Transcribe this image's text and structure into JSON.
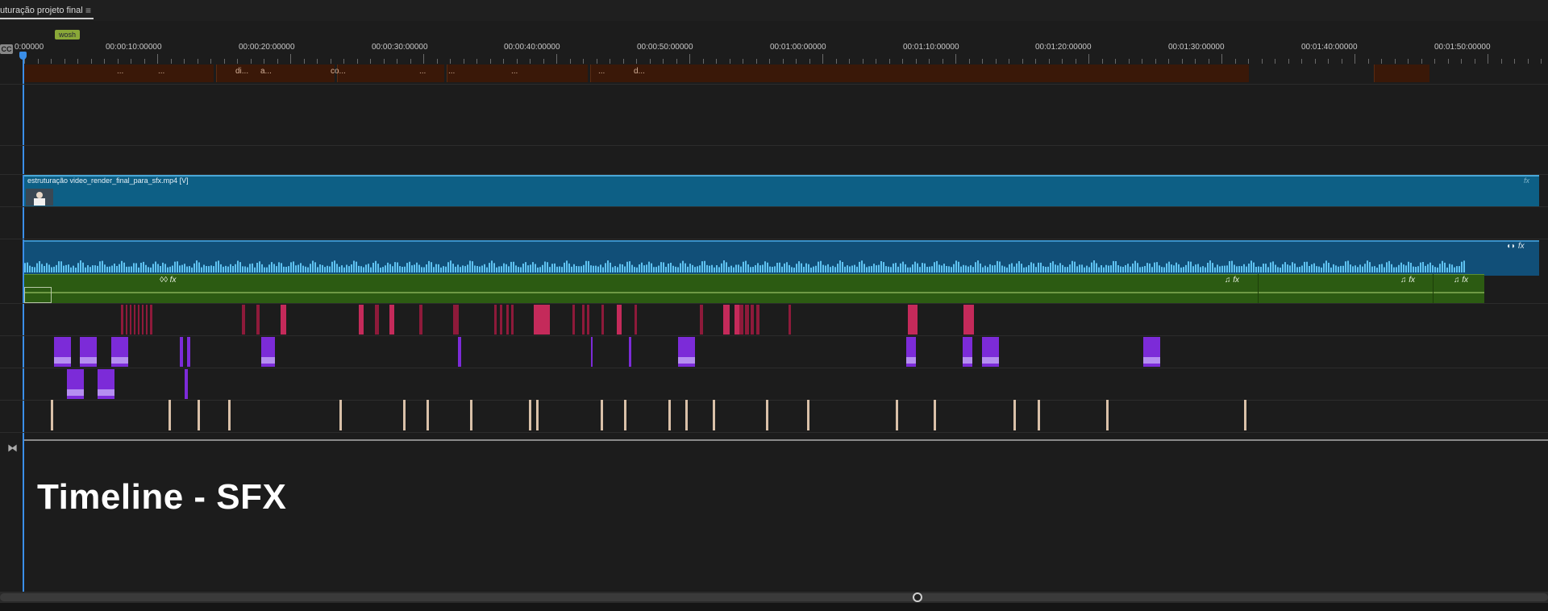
{
  "sequence": {
    "tab_title": "uturação projeto final",
    "menu_icon": "≡",
    "marker_label": "wosh",
    "cc_label": "CC"
  },
  "ruler": {
    "timecodes": [
      "0:00000",
      "00:00:10:00000",
      "00:00:20:00000",
      "00:00:30:00000",
      "00:00:40:00000",
      "00:00:50:00000",
      "00:01:00:00000",
      "00:01:10:00000",
      "00:01:20:00000",
      "00:01:30:00000",
      "00:01:40:00000",
      "00:01:50:00000"
    ]
  },
  "caption_track": {
    "labels": [
      "...",
      "...",
      "di...",
      "a...",
      "co...",
      "...",
      "...",
      "...",
      "...",
      "d..."
    ]
  },
  "video_clip": {
    "title": "estruturação video_render_final_para_sfx.mp4 [V]",
    "fx_label": "fx"
  },
  "audio_clip": {
    "icons": "◖◗ fx"
  },
  "music_clip": {
    "icons": [
      "♫  fx",
      "♫  fx",
      "♫  fx"
    ],
    "first_icons": "◊◊  fx"
  },
  "overlay": {
    "title": "Timeline - SFX"
  },
  "icons": {
    "menu": "hamburger-icon",
    "bowtie": "collapse-tracks-icon",
    "scroll": "scroll-handle-icon"
  },
  "colors": {
    "video": "#0d5f85",
    "audio": "#114f78",
    "music": "#2c5b12",
    "sfx_red": "#8e1a3a",
    "sfx_purple": "#7c2bd8",
    "sfx_beige": "#d9c0a8",
    "caption": "#3a1808",
    "playhead": "#3a8ee8"
  }
}
